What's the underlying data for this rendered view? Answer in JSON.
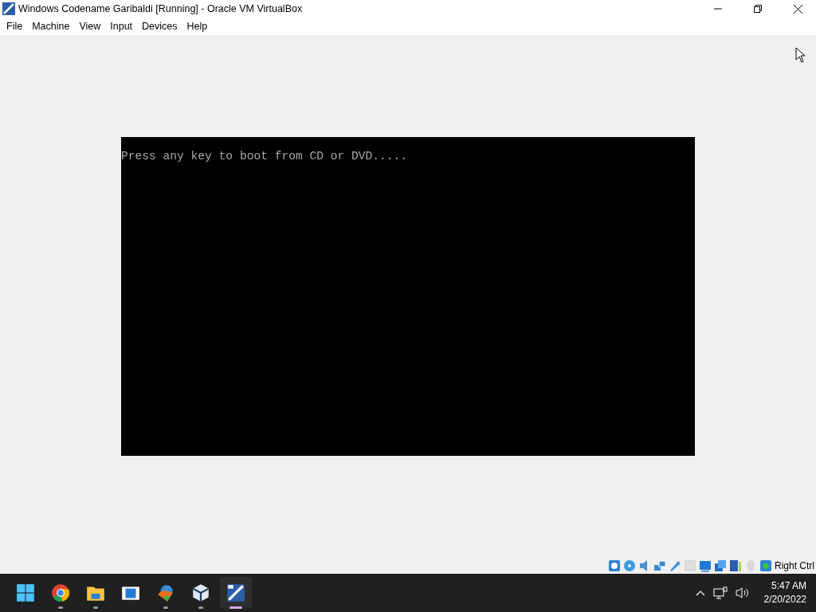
{
  "window": {
    "title": "Windows Codename Garibaldi [Running] - Oracle VM VirtualBox"
  },
  "menu": [
    "File",
    "Machine",
    "View",
    "Input",
    "Devices",
    "Help"
  ],
  "vm_screen": {
    "text": "Press any key to boot from CD or DVD....."
  },
  "status_bar": {
    "host_key": "Right Ctrl"
  },
  "taskbar": {
    "apps": [
      {
        "kind": "start",
        "running": false,
        "selected": false
      },
      {
        "kind": "browser",
        "running": true,
        "selected": false
      },
      {
        "kind": "folder",
        "running": true,
        "selected": false
      },
      {
        "kind": "window",
        "running": false,
        "selected": false
      },
      {
        "kind": "globe",
        "running": true,
        "selected": false
      },
      {
        "kind": "cube",
        "running": true,
        "selected": false
      },
      {
        "kind": "vista",
        "running": true,
        "selected": true
      }
    ],
    "time": "5:47 AM",
    "date": "2/20/2022"
  }
}
